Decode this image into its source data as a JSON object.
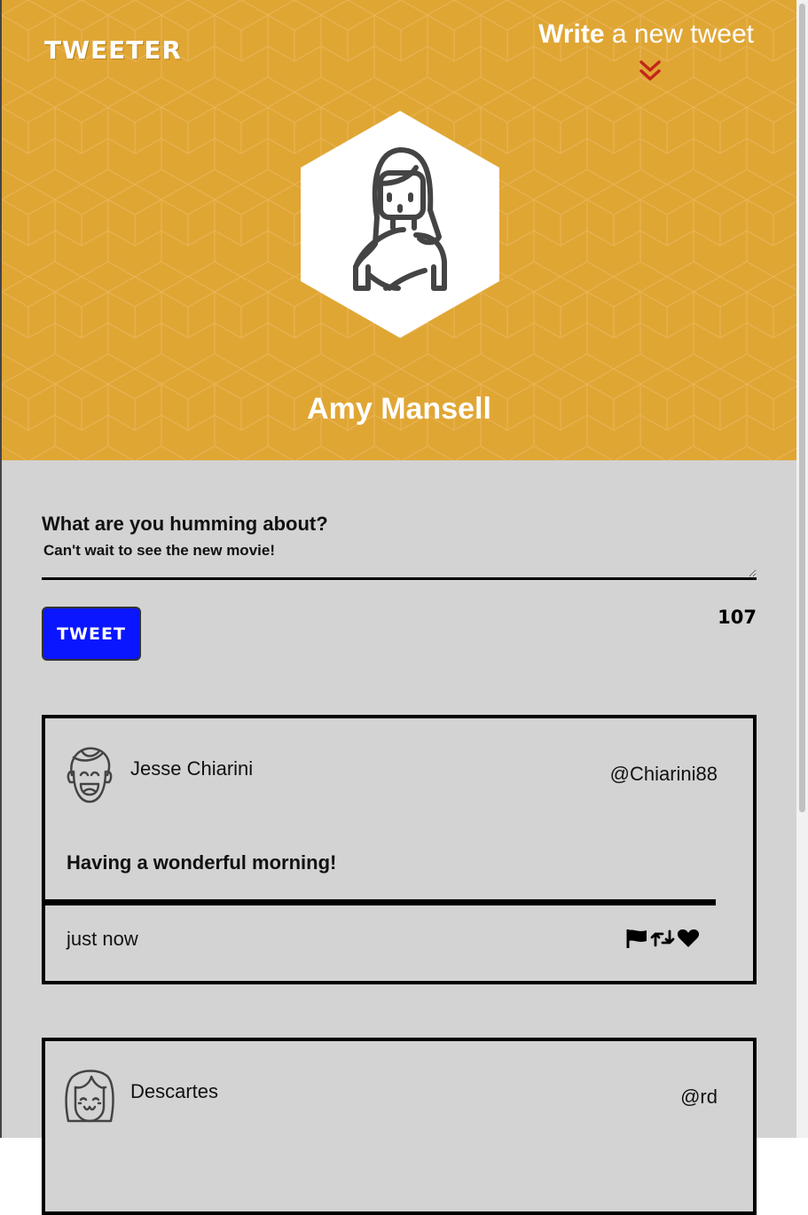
{
  "header": {
    "logo": "TWEETER",
    "write_bold": "Write",
    "write_rest": " a new tweet",
    "chevron_icon": "double-chevron-down-icon",
    "accent": "#e0a634",
    "chevron_color": "#c3261a"
  },
  "profile": {
    "name": "Amy Mansell",
    "avatar_icon": "woman-avatar-icon"
  },
  "composer": {
    "label": "What are you humming about?",
    "value": "Can't wait to see the new movie!",
    "button_label": "TWEET",
    "button_color": "#0a16ff",
    "counter": "107"
  },
  "tweets": [
    {
      "name": "Jesse Chiarini",
      "handle": "@Chiarini88",
      "text": "Having a wonderful morning!",
      "time": "just now",
      "avatar_icon": "laughing-man-avatar-icon",
      "actions": [
        "flag-icon",
        "retweet-icon",
        "heart-icon"
      ]
    },
    {
      "name": "Descartes",
      "handle": "@rd",
      "avatar_icon": "smiling-girl-avatar-icon"
    }
  ]
}
